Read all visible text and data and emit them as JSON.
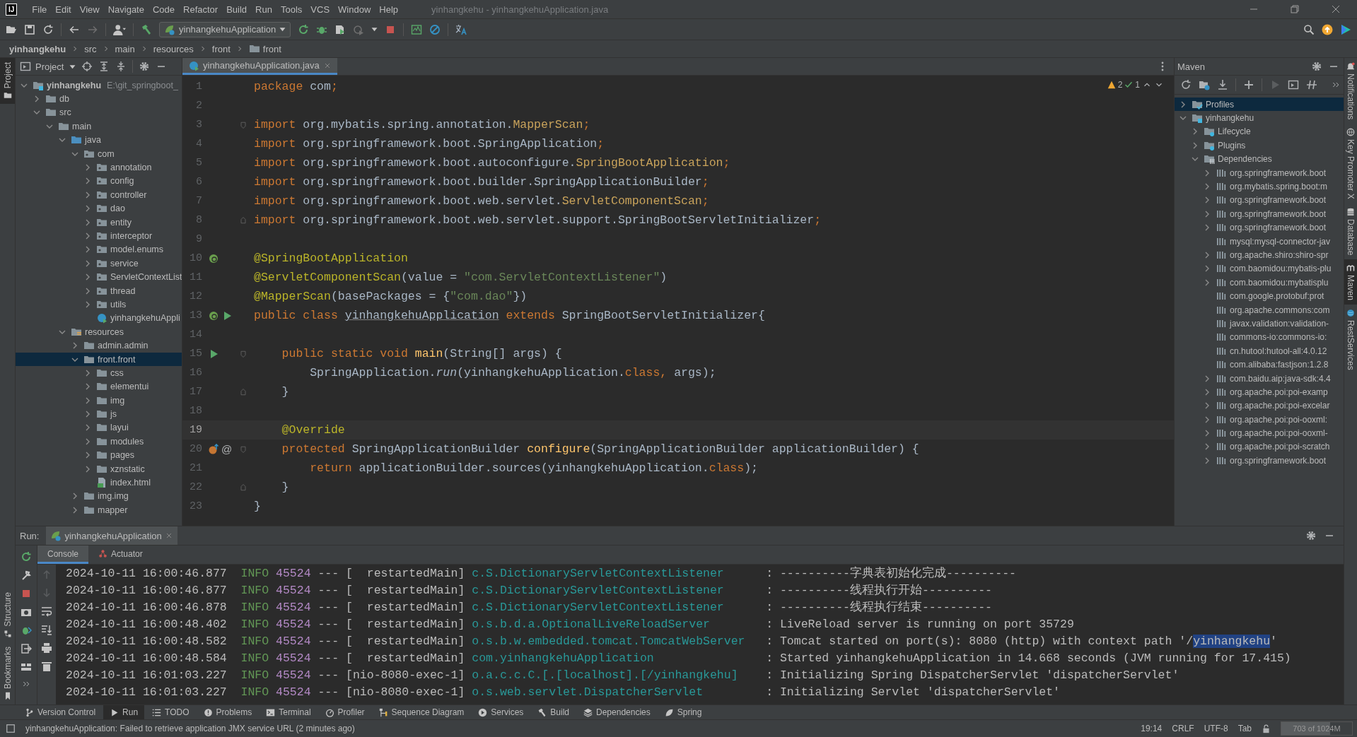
{
  "window": {
    "logo_text": "IJ",
    "menu": [
      "File",
      "Edit",
      "View",
      "Navigate",
      "Code",
      "Refactor",
      "Build",
      "Run",
      "Tools",
      "VCS",
      "Window",
      "Help"
    ],
    "title": "yinhangkehu - yinhangkehuApplication.java"
  },
  "toolbar": {
    "run_configuration": "yinhangkehuApplication"
  },
  "breadcrumb": [
    {
      "label": "yinhangkehu",
      "kind": "project"
    },
    {
      "label": "src",
      "kind": "plain"
    },
    {
      "label": "main",
      "kind": "plain"
    },
    {
      "label": "resources",
      "kind": "plain"
    },
    {
      "label": "front",
      "kind": "plain"
    },
    {
      "label": "front",
      "kind": "folder"
    }
  ],
  "left_stripe": {
    "top": [
      {
        "label": "Project",
        "selected": true
      }
    ],
    "bottom": [
      {
        "label": "Structure",
        "selected": false
      },
      {
        "label": "Bookmarks",
        "selected": false
      }
    ]
  },
  "project": {
    "title": "Project",
    "tree": [
      {
        "label": "yinhangkehu",
        "path": "E:\\git_springboot_",
        "kind": "module",
        "expanded": true,
        "selected": false,
        "children": [
          {
            "label": "db",
            "kind": "folder",
            "expanded": false,
            "selected": false
          },
          {
            "label": "src",
            "kind": "folder",
            "expanded": true,
            "selected": false,
            "children": [
              {
                "label": "main",
                "kind": "folder",
                "expanded": true,
                "selected": false,
                "children": [
                  {
                    "label": "java",
                    "kind": "source",
                    "expanded": true,
                    "selected": false,
                    "children": [
                      {
                        "label": "com",
                        "kind": "package",
                        "expanded": true,
                        "selected": false,
                        "children": [
                          {
                            "label": "annotation",
                            "kind": "package",
                            "expanded": false,
                            "selected": false
                          },
                          {
                            "label": "config",
                            "kind": "package",
                            "expanded": false,
                            "selected": false
                          },
                          {
                            "label": "controller",
                            "kind": "package",
                            "expanded": false,
                            "selected": false
                          },
                          {
                            "label": "dao",
                            "kind": "package",
                            "expanded": false,
                            "selected": false
                          },
                          {
                            "label": "entity",
                            "kind": "package",
                            "expanded": false,
                            "selected": false
                          },
                          {
                            "label": "interceptor",
                            "kind": "package",
                            "expanded": false,
                            "selected": false
                          },
                          {
                            "label": "model.enums",
                            "kind": "package",
                            "expanded": false,
                            "selected": false
                          },
                          {
                            "label": "service",
                            "kind": "package",
                            "expanded": false,
                            "selected": false
                          },
                          {
                            "label": "ServletContextList",
                            "kind": "package",
                            "expanded": false,
                            "selected": false
                          },
                          {
                            "label": "thread",
                            "kind": "package",
                            "expanded": false,
                            "selected": false
                          },
                          {
                            "label": "utils",
                            "kind": "package",
                            "expanded": false,
                            "selected": false
                          },
                          {
                            "label": "yinhangkehuAppli",
                            "kind": "class",
                            "selected": false
                          }
                        ]
                      }
                    ]
                  },
                  {
                    "label": "resources",
                    "kind": "resources",
                    "expanded": true,
                    "selected": false,
                    "children": [
                      {
                        "label": "admin.admin",
                        "kind": "folder",
                        "expanded": false,
                        "selected": false
                      },
                      {
                        "label": "front.front",
                        "kind": "folder",
                        "expanded": true,
                        "selected": true,
                        "children": [
                          {
                            "label": "css",
                            "kind": "folder",
                            "expanded": false,
                            "selected": false
                          },
                          {
                            "label": "elementui",
                            "kind": "folder",
                            "expanded": false,
                            "selected": false
                          },
                          {
                            "label": "img",
                            "kind": "folder",
                            "expanded": false,
                            "selected": false
                          },
                          {
                            "label": "js",
                            "kind": "folder",
                            "expanded": false,
                            "selected": false
                          },
                          {
                            "label": "layui",
                            "kind": "folder",
                            "expanded": false,
                            "selected": false
                          },
                          {
                            "label": "modules",
                            "kind": "folder",
                            "expanded": false,
                            "selected": false
                          },
                          {
                            "label": "pages",
                            "kind": "folder",
                            "expanded": false,
                            "selected": false
                          },
                          {
                            "label": "xznstatic",
                            "kind": "folder",
                            "expanded": false,
                            "selected": false
                          },
                          {
                            "label": "index.html",
                            "kind": "html",
                            "selected": false
                          }
                        ]
                      },
                      {
                        "label": "img.img",
                        "kind": "folder",
                        "expanded": false,
                        "selected": false
                      },
                      {
                        "label": "mapper",
                        "kind": "folder",
                        "expanded": false,
                        "selected": false
                      }
                    ]
                  }
                ]
              }
            ]
          }
        ]
      }
    ]
  },
  "editor": {
    "tab": {
      "label": "yinhangkehuApplication.java",
      "selected": true
    },
    "warnings": "2",
    "checks": "1",
    "lines": [
      {
        "number": "1",
        "current": false,
        "tokens": [
          {
            "kind": "keyword",
            "text": "package"
          },
          {
            "kind": "plain",
            "text": " com"
          },
          {
            "kind": "keyword",
            "text": ";"
          }
        ]
      },
      {
        "number": "2",
        "current": false
      },
      {
        "number": "3",
        "current": false,
        "fold": {
          "kind": "start"
        },
        "tokens": [
          {
            "kind": "keyword",
            "text": "import"
          },
          {
            "kind": "plain",
            "text": " org.mybatis.spring.annotation."
          },
          {
            "kind": "import_class",
            "text": "MapperScan"
          },
          {
            "kind": "keyword",
            "text": ";"
          }
        ]
      },
      {
        "number": "4",
        "current": false,
        "tokens": [
          {
            "kind": "keyword",
            "text": "import"
          },
          {
            "kind": "plain",
            "text": " org.springframework.boot.SpringApplication"
          },
          {
            "kind": "keyword",
            "text": ";"
          }
        ]
      },
      {
        "number": "5",
        "current": false,
        "tokens": [
          {
            "kind": "keyword",
            "text": "import"
          },
          {
            "kind": "plain",
            "text": " org.springframework.boot.autoconfigure."
          },
          {
            "kind": "import_class",
            "text": "SpringBootApplication"
          },
          {
            "kind": "keyword",
            "text": ";"
          }
        ]
      },
      {
        "number": "6",
        "current": false,
        "tokens": [
          {
            "kind": "keyword",
            "text": "import"
          },
          {
            "kind": "plain",
            "text": " org.springframework.boot.builder.SpringApplicationBuilder"
          },
          {
            "kind": "keyword",
            "text": ";"
          }
        ]
      },
      {
        "number": "7",
        "current": false,
        "tokens": [
          {
            "kind": "keyword",
            "text": "import"
          },
          {
            "kind": "plain",
            "text": " org.springframework.boot.web.servlet."
          },
          {
            "kind": "import_class",
            "text": "ServletComponentScan"
          },
          {
            "kind": "keyword",
            "text": ";"
          }
        ]
      },
      {
        "number": "8",
        "current": false,
        "fold": {
          "kind": "end"
        },
        "tokens": [
          {
            "kind": "keyword",
            "text": "import"
          },
          {
            "kind": "plain",
            "text": " org.springframework.boot.web.servlet.support.SpringBootServletInitializer"
          },
          {
            "kind": "keyword",
            "text": ";"
          }
        ]
      },
      {
        "number": "9",
        "current": false
      },
      {
        "number": "10",
        "current": false,
        "gutter": [
          {
            "kind": "bean"
          }
        ],
        "tokens": [
          {
            "kind": "annotation",
            "text": "@SpringBootApplication"
          }
        ]
      },
      {
        "number": "11",
        "current": false,
        "tokens": [
          {
            "kind": "annotation",
            "text": "@ServletComponentScan"
          },
          {
            "kind": "plain",
            "text": "(value = "
          },
          {
            "kind": "string",
            "text": "\"com.ServletContextListener\""
          },
          {
            "kind": "plain",
            "text": ")"
          }
        ]
      },
      {
        "number": "12",
        "current": false,
        "tokens": [
          {
            "kind": "annotation",
            "text": "@MapperScan"
          },
          {
            "kind": "plain",
            "text": "(basePackages = {"
          },
          {
            "kind": "string",
            "text": "\"com.dao\""
          },
          {
            "kind": "plain",
            "text": "})"
          }
        ]
      },
      {
        "number": "13",
        "current": false,
        "gutter": [
          {
            "kind": "bean"
          },
          {
            "kind": "run"
          }
        ],
        "tokens": [
          {
            "kind": "keyword",
            "text": "public class "
          },
          {
            "kind": "underlined",
            "text": "yinhangkehuApplication"
          },
          {
            "kind": "keyword",
            "text": " extends"
          },
          {
            "kind": "plain",
            "text": " SpringBootServletInitializer{"
          }
        ]
      },
      {
        "number": "14",
        "current": false
      },
      {
        "number": "15",
        "current": false,
        "gutter": [
          {
            "kind": "run"
          }
        ],
        "fold": {
          "kind": "start"
        },
        "tokens": [
          {
            "kind": "keyword",
            "text": "    public static void "
          },
          {
            "kind": "method",
            "text": "main"
          },
          {
            "kind": "plain",
            "text": "(String[] args) {"
          }
        ]
      },
      {
        "number": "16",
        "current": false,
        "tokens": [
          {
            "kind": "plain",
            "text": "        SpringApplication."
          },
          {
            "kind": "italic",
            "text": "run"
          },
          {
            "kind": "plain",
            "text": "(yinhangkehuApplication."
          },
          {
            "kind": "keyword",
            "text": "class, "
          },
          {
            "kind": "plain",
            "text": "args);"
          }
        ]
      },
      {
        "number": "17",
        "current": false,
        "fold": {
          "kind": "end"
        },
        "tokens": [
          {
            "kind": "plain",
            "text": "    }"
          }
        ]
      },
      {
        "number": "18",
        "current": false
      },
      {
        "number": "19",
        "current": true,
        "tokens": [
          {
            "kind": "annotation",
            "text": "    @Override"
          }
        ]
      },
      {
        "number": "20",
        "current": false,
        "gutter": [
          {
            "kind": "override"
          },
          {
            "kind": "symbol",
            "text": "@"
          }
        ],
        "fold": {
          "kind": "start"
        },
        "tokens": [
          {
            "kind": "keyword",
            "text": "    protected "
          },
          {
            "kind": "plain",
            "text": "SpringApplicationBuilder "
          },
          {
            "kind": "method",
            "text": "configure"
          },
          {
            "kind": "plain",
            "text": "(SpringApplicationBuilder applicationBuilder) {"
          }
        ]
      },
      {
        "number": "21",
        "current": false,
        "tokens": [
          {
            "kind": "keyword",
            "text": "        return "
          },
          {
            "kind": "plain",
            "text": "applicationBuilder.sources(yinhangkehuApplication."
          },
          {
            "kind": "keyword",
            "text": "class"
          },
          {
            "kind": "plain",
            "text": ");"
          }
        ]
      },
      {
        "number": "22",
        "current": false,
        "fold": {
          "kind": "end"
        },
        "tokens": [
          {
            "kind": "plain",
            "text": "    }"
          }
        ]
      },
      {
        "number": "23",
        "current": false,
        "tokens": [
          {
            "kind": "plain",
            "text": "}"
          }
        ]
      }
    ]
  },
  "maven": {
    "title": "Maven",
    "tree": [
      {
        "label": "Profiles",
        "kind": "profiles",
        "expanded": false,
        "selected": true
      },
      {
        "label": "yinhangkehu",
        "kind": "project",
        "expanded": true,
        "selected": false,
        "children": [
          {
            "label": "Lifecycle",
            "kind": "lifecycle",
            "expanded": false,
            "selected": false
          },
          {
            "label": "Plugins",
            "kind": "plugins",
            "expanded": false,
            "selected": false
          },
          {
            "label": "Dependencies",
            "kind": "dependencies",
            "expanded": true,
            "selected": false,
            "children": [
              {
                "label": "org.springframework.boot",
                "kind": "library",
                "expanded": false,
                "selected": false
              },
              {
                "label": "org.mybatis.spring.boot:m",
                "kind": "library",
                "expanded": false,
                "selected": false
              },
              {
                "label": "org.springframework.boot",
                "kind": "library",
                "expanded": false,
                "selected": false
              },
              {
                "label": "org.springframework.boot",
                "kind": "library",
                "expanded": false,
                "selected": false
              },
              {
                "label": "org.springframework.boot",
                "kind": "library",
                "expanded": false,
                "selected": false
              },
              {
                "label": "mysql:mysql-connector-jav",
                "kind": "library",
                "selected": false
              },
              {
                "label": "org.apache.shiro:shiro-spr",
                "kind": "library",
                "expanded": false,
                "selected": false
              },
              {
                "label": "com.baomidou:mybatis-plu",
                "kind": "library",
                "expanded": false,
                "selected": false
              },
              {
                "label": "com.baomidou:mybatisplu",
                "kind": "library",
                "expanded": false,
                "selected": false
              },
              {
                "label": "com.google.protobuf:prot",
                "kind": "library",
                "selected": false
              },
              {
                "label": "org.apache.commons:com",
                "kind": "library",
                "selected": false
              },
              {
                "label": "javax.validation:validation-",
                "kind": "library",
                "selected": false
              },
              {
                "label": "commons-io:commons-io:",
                "kind": "library",
                "selected": false
              },
              {
                "label": "cn.hutool:hutool-all:4.0.12",
                "kind": "library",
                "selected": false
              },
              {
                "label": "com.alibaba:fastjson:1.2.8",
                "kind": "library",
                "selected": false
              },
              {
                "label": "com.baidu.aip:java-sdk:4.4",
                "kind": "library",
                "expanded": false,
                "selected": false
              },
              {
                "label": "org.apache.poi:poi-examp",
                "kind": "library",
                "expanded": false,
                "selected": false
              },
              {
                "label": "org.apache.poi:poi-excelar",
                "kind": "library",
                "expanded": false,
                "selected": false
              },
              {
                "label": "org.apache.poi:poi-ooxml:",
                "kind": "library",
                "expanded": false,
                "selected": false
              },
              {
                "label": "org.apache.poi:poi-ooxml-",
                "kind": "library",
                "expanded": false,
                "selected": false
              },
              {
                "label": "org.apache.poi:poi-scratch",
                "kind": "library",
                "expanded": false,
                "selected": false
              },
              {
                "label": "org.springframework.boot",
                "kind": "library",
                "expanded": false,
                "selected": false
              }
            ]
          }
        ]
      }
    ]
  },
  "right_stripe": [
    {
      "label": "Notifications",
      "kind": "bell",
      "selected": false
    },
    {
      "label": "Key Promoter X",
      "kind": "globe",
      "selected": false
    },
    {
      "label": "Database",
      "kind": "database",
      "selected": false
    },
    {
      "label": "Maven",
      "kind": "maven",
      "selected": true
    },
    {
      "label": "RestServices",
      "kind": "rest",
      "selected": false
    }
  ],
  "run": {
    "label": "Run:",
    "tab": "yinhangkehuApplication",
    "subtabs": [
      {
        "label": "Console",
        "kind": "console",
        "selected": true
      },
      {
        "label": "Actuator",
        "kind": "actuator",
        "selected": false
      }
    ],
    "log": [
      {
        "time": "2024-10-11 16:00:46.877",
        "level": "INFO",
        "pid": "45524",
        "separator": "---",
        "thread": "[  restartedMain]",
        "logger": "c.S.DictionaryServletContextListener",
        "message": [
          {
            "text": ": ----------字典表初始化完成----------",
            "selected": false
          }
        ]
      },
      {
        "time": "2024-10-11 16:00:46.877",
        "level": "INFO",
        "pid": "45524",
        "separator": "---",
        "thread": "[  restartedMain]",
        "logger": "c.S.DictionaryServletContextListener",
        "message": [
          {
            "text": ": ----------线程执行开始----------",
            "selected": false
          }
        ]
      },
      {
        "time": "2024-10-11 16:00:46.878",
        "level": "INFO",
        "pid": "45524",
        "separator": "---",
        "thread": "[  restartedMain]",
        "logger": "c.S.DictionaryServletContextListener",
        "message": [
          {
            "text": ": ----------线程执行结束----------",
            "selected": false
          }
        ]
      },
      {
        "time": "2024-10-11 16:00:48.402",
        "level": "INFO",
        "pid": "45524",
        "separator": "---",
        "thread": "[  restartedMain]",
        "logger": "o.s.b.d.a.OptionalLiveReloadServer",
        "message": [
          {
            "text": ": LiveReload server is running on port 35729",
            "selected": false
          }
        ]
      },
      {
        "time": "2024-10-11 16:00:48.582",
        "level": "INFO",
        "pid": "45524",
        "separator": "---",
        "thread": "[  restartedMain]",
        "logger": "o.s.b.w.embedded.tomcat.TomcatWebServer",
        "message": [
          {
            "text": ": Tomcat started on port(s): 8080 (http) with context path '/",
            "selected": false
          },
          {
            "text": "yinhangkehu",
            "selected": true
          },
          {
            "text": "'",
            "selected": false
          }
        ]
      },
      {
        "time": "2024-10-11 16:00:48.584",
        "level": "INFO",
        "pid": "45524",
        "separator": "---",
        "thread": "[  restartedMain]",
        "logger": "com.yinhangkehuApplication",
        "message": [
          {
            "text": ": Started yinhangkehuApplication in 14.668 seconds (JVM running for 17.415)",
            "selected": false
          }
        ]
      },
      {
        "time": "2024-10-11 16:01:03.227",
        "level": "INFO",
        "pid": "45524",
        "separator": "---",
        "thread": "[nio-8080-exec-1]",
        "logger": "o.a.c.c.C.[.[localhost].[/yinhangkehu]",
        "message": [
          {
            "text": ": Initializing Spring DispatcherServlet 'dispatcherServlet'",
            "selected": false
          }
        ]
      },
      {
        "time": "2024-10-11 16:01:03.227",
        "level": "INFO",
        "pid": "45524",
        "separator": "---",
        "thread": "[nio-8080-exec-1]",
        "logger": "o.s.web.servlet.DispatcherServlet",
        "message": [
          {
            "text": ": Initializing Servlet 'dispatcherServlet'",
            "selected": false
          }
        ]
      }
    ]
  },
  "tool_windows": [
    {
      "label": "Version Control",
      "kind": "vcs",
      "selected": false
    },
    {
      "label": "Run",
      "kind": "run",
      "selected": true
    },
    {
      "label": "TODO",
      "kind": "todo",
      "selected": false
    },
    {
      "label": "Problems",
      "kind": "problems",
      "selected": false
    },
    {
      "label": "Terminal",
      "kind": "terminal",
      "selected": false
    },
    {
      "label": "Profiler",
      "kind": "profiler",
      "selected": false
    },
    {
      "label": "Sequence Diagram",
      "kind": "sequence",
      "selected": false
    },
    {
      "label": "Services",
      "kind": "services",
      "selected": false
    },
    {
      "label": "Build",
      "kind": "build",
      "selected": false
    },
    {
      "label": "Dependencies",
      "kind": "dependencies",
      "selected": false
    },
    {
      "label": "Spring",
      "kind": "spring",
      "selected": false
    }
  ],
  "status_bar": {
    "message": "yinhangkehuApplication: Failed to retrieve application JMX service URL (2 minutes ago)",
    "position": "19:14",
    "line_separator": "CRLF",
    "encoding": "UTF-8",
    "indent": "Tab",
    "memory": {
      "text": "703 of 1024M",
      "level": 0.69
    }
  }
}
